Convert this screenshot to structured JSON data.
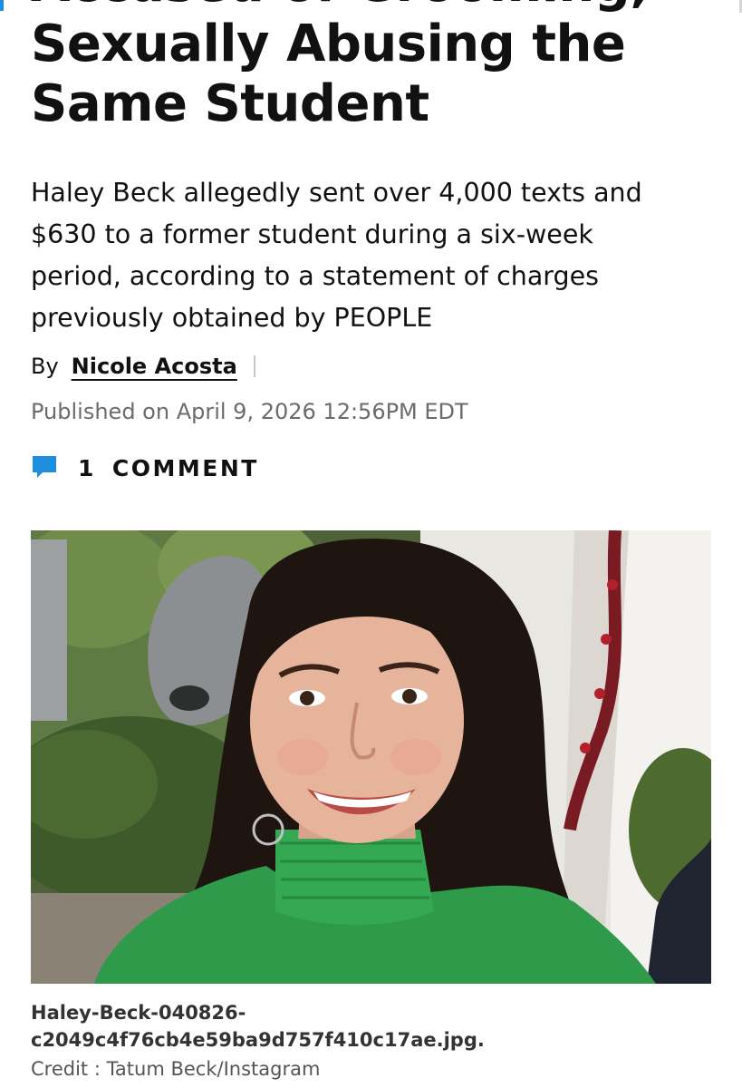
{
  "article": {
    "headline_lines": [
      "Accused of Grooming,",
      "Sexually Abusing the",
      "Same Student"
    ],
    "dek_lines": [
      "Haley Beck allegedly sent over 4,000 texts and",
      "$630 to a former student during a six-week",
      "period, according to a statement of charges",
      "previously obtained by PEOPLE"
    ],
    "byline_prefix": "By",
    "author": "Nicole Acosta",
    "published": "Published on April 9, 2026 12:56PM EDT",
    "comments": {
      "count": "1",
      "label": "COMMENT",
      "icon": "comment-bubble-icon",
      "icon_color": "#1e8fe0"
    }
  },
  "image": {
    "caption_file_lines": [
      "Haley-Beck-040826-",
      "c2049c4f76cb4e59ba9d757f410c17ae.jpg."
    ],
    "credit": "Credit : Tatum Beck/Instagram"
  },
  "colors": {
    "accent": "#1e8fe0",
    "text": "#111111",
    "muted": "#6b6b6b"
  }
}
